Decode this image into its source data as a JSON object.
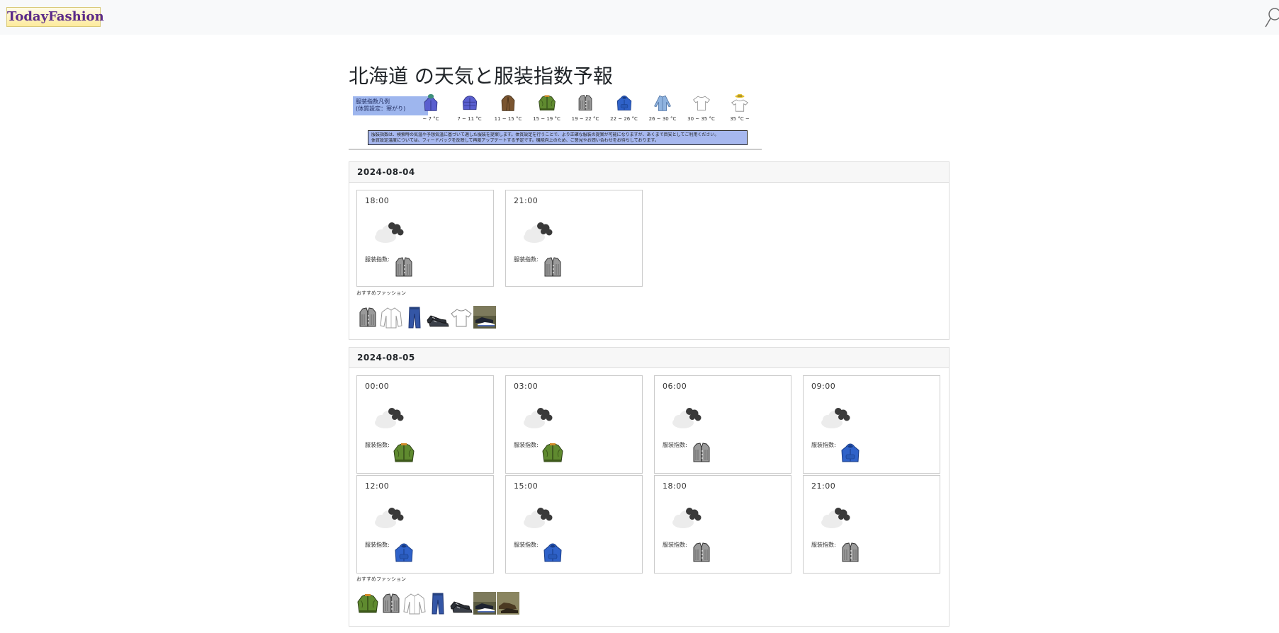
{
  "app": {
    "logo": "TodayFashion"
  },
  "page": {
    "title": "北海道 の天気と服装指数予報"
  },
  "legend": {
    "title_line1": "服装指数凡例",
    "title_line2": "(体質設定：寒がり)",
    "items": [
      {
        "icon": "winter-coat-icon",
        "label": "~ 7 °C"
      },
      {
        "icon": "down-jacket-icon",
        "label": "7 ~ 11 °C"
      },
      {
        "icon": "trench-coat-icon",
        "label": "11 ~ 15 °C"
      },
      {
        "icon": "bomber-jacket-icon",
        "label": "15 ~ 19 °C"
      },
      {
        "icon": "cardigan-icon",
        "label": "19 ~ 22 °C"
      },
      {
        "icon": "hoodie-icon",
        "label": "22 ~ 26 °C"
      },
      {
        "icon": "long-sleeve-shirt-icon",
        "label": "26 ~ 30 °C"
      },
      {
        "icon": "t-shirt-icon",
        "label": "30 ~ 35 °C"
      },
      {
        "icon": "tshirt-hat-icon",
        "label": "35 °C ~"
      }
    ],
    "note_line1": "服装指数は、検索時の気温や予想気温に基づいて適した服装を提案します。体質設定を行うことで、より正確な服装の提案が可能になりますが、あくまで目安としてご利用ください。",
    "note_line2": "体質設定温度については、フィードバックを反映して再度アップデートする予定です。機能向上のため、ご意見やお問い合わせをお待ちしております。"
  },
  "index_label": "服装指数:",
  "rec_label": "おすすめファッション",
  "days": [
    {
      "date": "2024-08-04",
      "slots": [
        {
          "time": "18:00",
          "weather": "cloudy-night-icon",
          "index_icon": "cardigan-icon"
        },
        {
          "time": "21:00",
          "weather": "cloudy-night-icon",
          "index_icon": "cardigan-icon"
        }
      ],
      "recommend": [
        "cardigan-icon",
        "white-shirt-icon",
        "jeans-icon",
        "sneakers-icon",
        "t-shirt-icon",
        "shoes-photo-icon"
      ]
    },
    {
      "date": "2024-08-05",
      "slots": [
        {
          "time": "00:00",
          "weather": "cloudy-night-icon",
          "index_icon": "bomber-jacket-icon"
        },
        {
          "time": "03:00",
          "weather": "cloudy-night-icon",
          "index_icon": "bomber-jacket-icon"
        },
        {
          "time": "06:00",
          "weather": "cloudy-night-icon",
          "index_icon": "cardigan-icon"
        },
        {
          "time": "09:00",
          "weather": "cloudy-night-icon",
          "index_icon": "hoodie-icon"
        },
        {
          "time": "12:00",
          "weather": "cloudy-night-icon",
          "index_icon": "hoodie-icon"
        },
        {
          "time": "15:00",
          "weather": "cloudy-night-icon",
          "index_icon": "hoodie-icon"
        },
        {
          "time": "18:00",
          "weather": "cloudy-night-icon",
          "index_icon": "cardigan-icon"
        },
        {
          "time": "21:00",
          "weather": "cloudy-night-icon",
          "index_icon": "cardigan-icon"
        }
      ],
      "recommend": [
        "bomber-jacket-icon",
        "cardigan-icon",
        "white-shirt-icon",
        "jeans-icon",
        "sneakers-icon",
        "shoes-photo-icon",
        "boots-photo-icon"
      ]
    }
  ],
  "colors": {
    "navbar": "#f8f9fa",
    "legend_bg": "#9eb6ee",
    "accent_blue": "#2f62c9"
  }
}
